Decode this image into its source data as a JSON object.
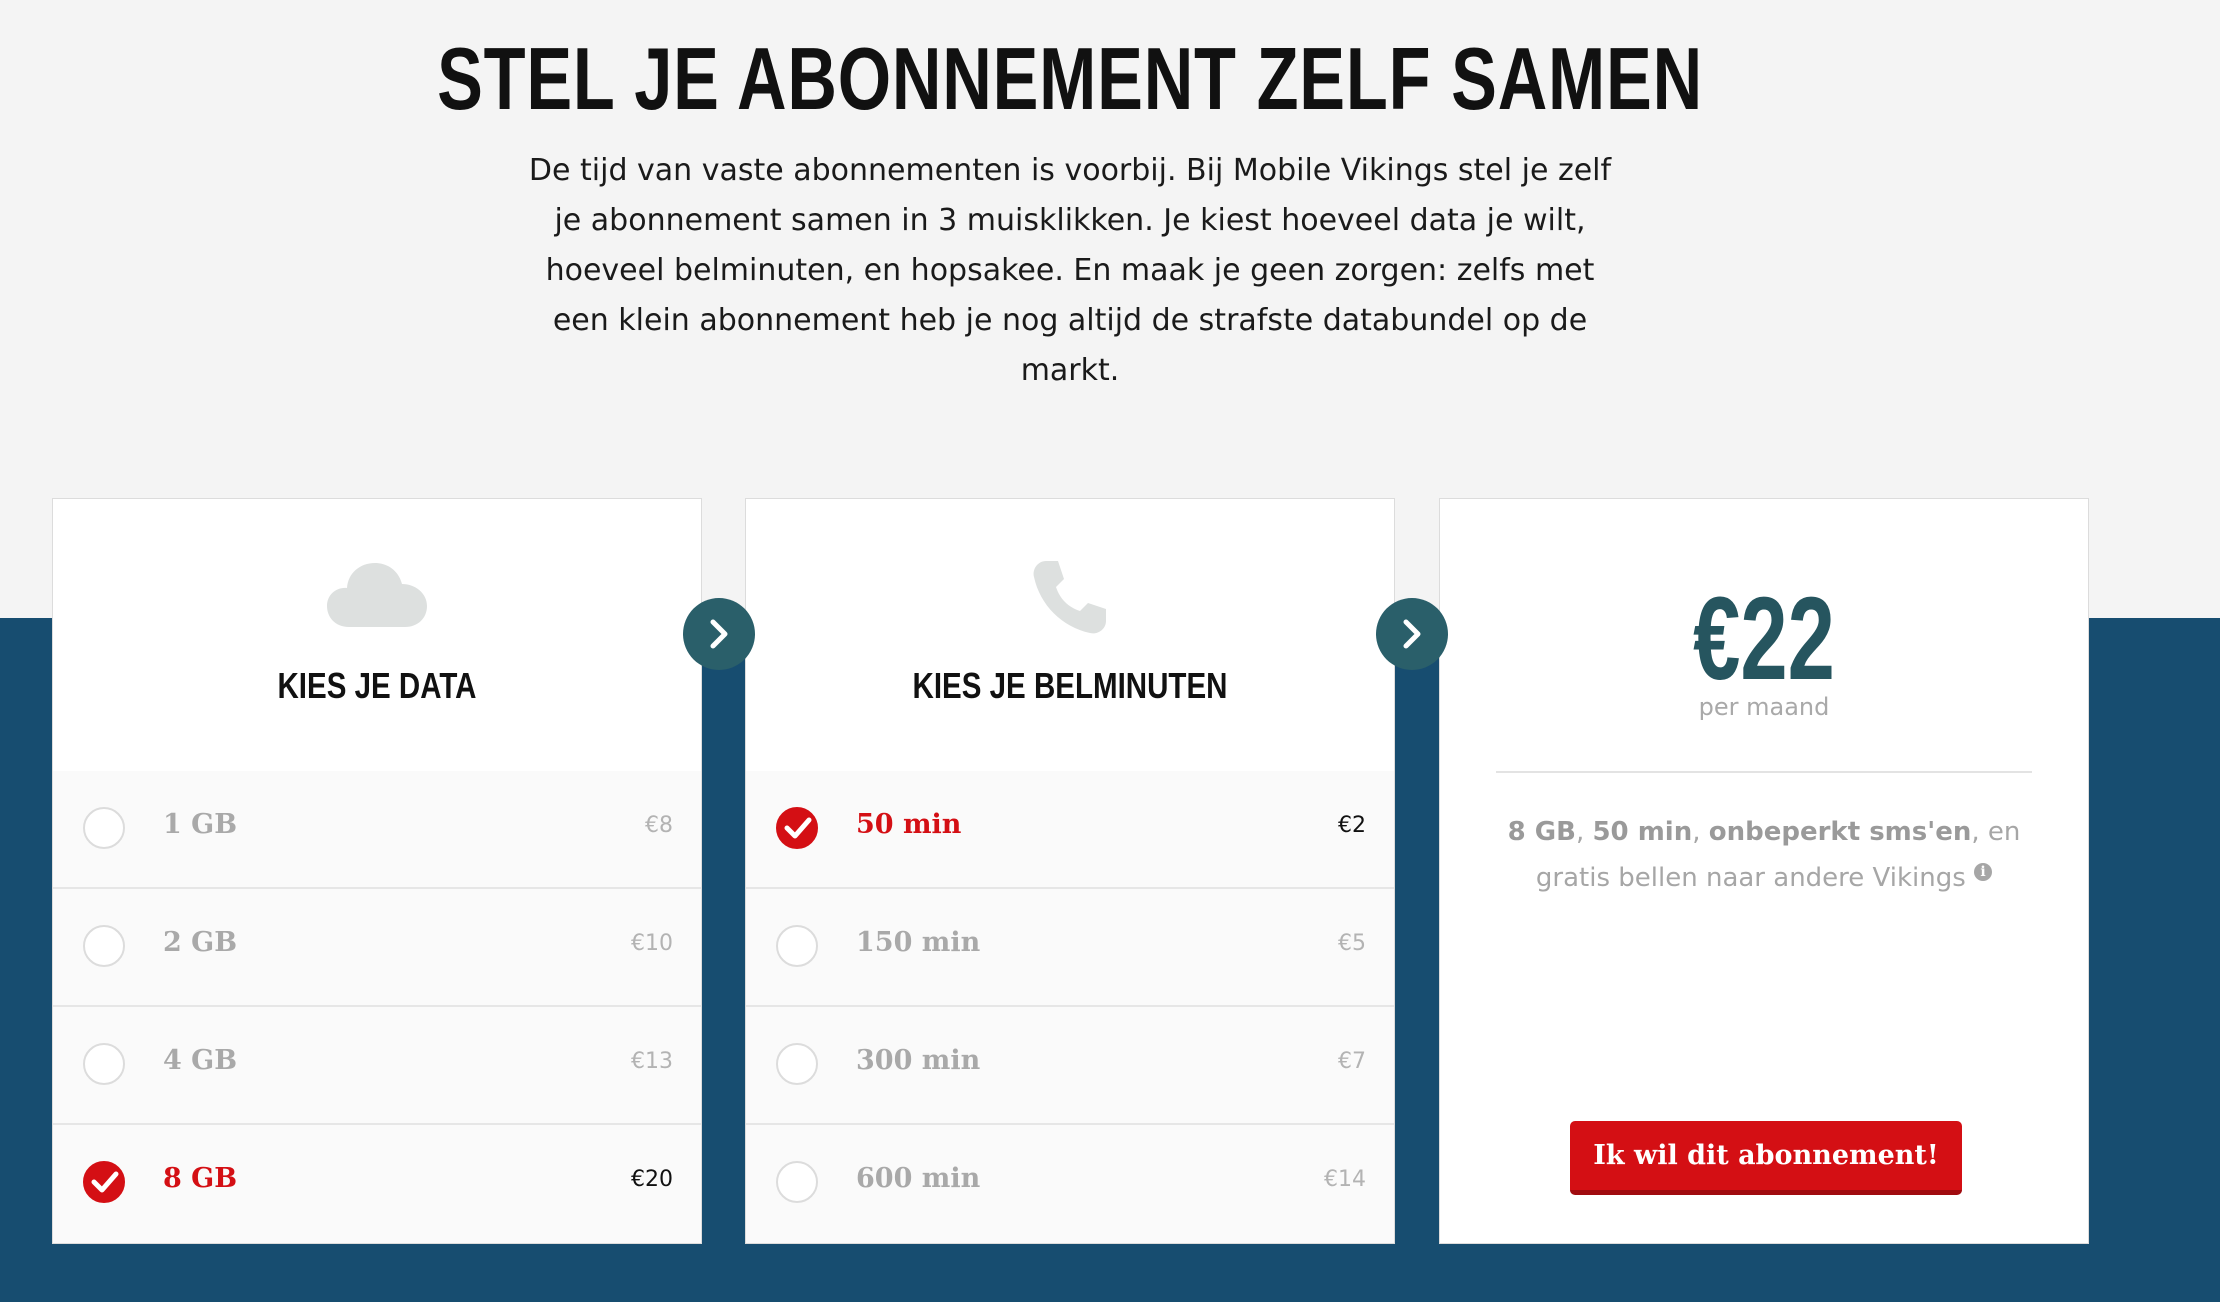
{
  "header": {
    "title": "STEL JE ABONNEMENT ZELF SAMEN",
    "intro": "De tijd van vaste abonnementen is voorbij. Bij Mobile Vikings stel je zelf je abonnement samen in 3 muisklikken. Je kiest hoeveel data je wilt, hoeveel belminuten, en hopsakee. En maak je geen zorgen: zelfs met een klein abonnement heb je nog altijd de strafste databundel op de markt."
  },
  "data_card": {
    "title": "KIES JE DATA",
    "icon": "cloud-icon",
    "options": [
      {
        "label": "1 GB",
        "price": "€8",
        "selected": false
      },
      {
        "label": "2 GB",
        "price": "€10",
        "selected": false
      },
      {
        "label": "4 GB",
        "price": "€13",
        "selected": false
      },
      {
        "label": "8 GB",
        "price": "€20",
        "selected": true
      }
    ]
  },
  "minutes_card": {
    "title": "KIES JE BELMINUTEN",
    "icon": "phone-icon",
    "options": [
      {
        "label": "50 min",
        "price": "€2",
        "selected": true
      },
      {
        "label": "150 min",
        "price": "€5",
        "selected": false
      },
      {
        "label": "300 min",
        "price": "€7",
        "selected": false
      },
      {
        "label": "600 min",
        "price": "€14",
        "selected": false
      }
    ]
  },
  "summary_card": {
    "price": "€22",
    "period": "per maand",
    "data": "8 GB",
    "sep1": ", ",
    "minutes": "50 min",
    "sep2": ", ",
    "sms": "onbeperkt sms'en",
    "rest": ", en gratis bellen naar andere Vikings",
    "info_glyph": "i",
    "cta_label": "Ik wil dit abonnement!"
  },
  "colors": {
    "accent_red": "#d40f14",
    "band_blue": "#174d70",
    "price_teal": "#26555f",
    "arrow_teal": "#2a5f6a"
  }
}
